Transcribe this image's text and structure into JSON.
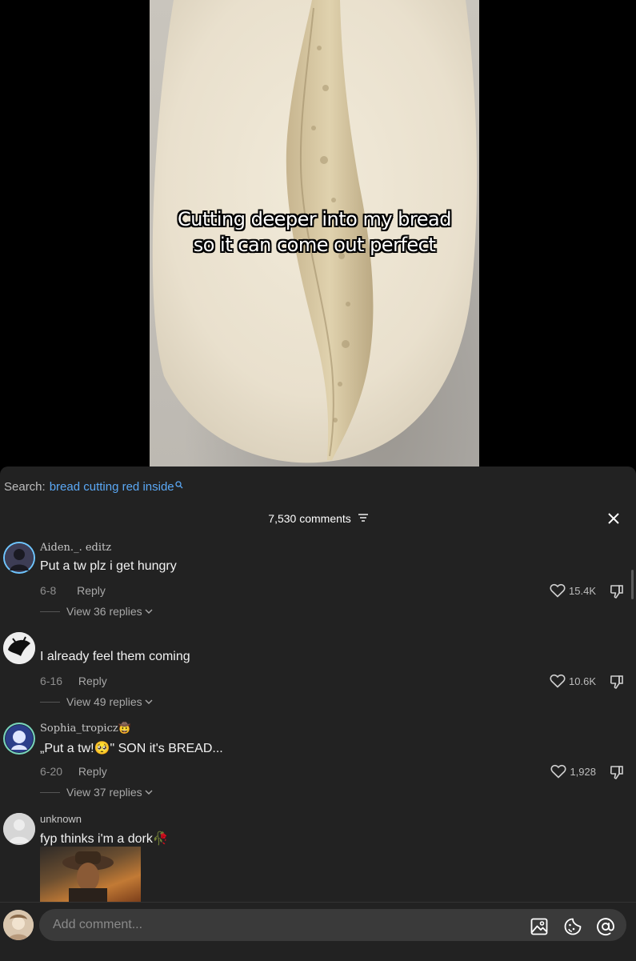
{
  "video": {
    "caption_lines": [
      "Cutting deeper into my bread",
      "so it can come out perfect"
    ]
  },
  "search": {
    "prefix": "Search:",
    "query": "bread cutting red inside"
  },
  "comments_header": {
    "count_label": "7,530 comments"
  },
  "comments": [
    {
      "username": "Aiden._. editz",
      "text": "Put a tw plz i get hungry",
      "date": "6-8",
      "reply_label": "Reply",
      "likes": "15.4K",
      "view_replies": "View 36 replies"
    },
    {
      "username": "",
      "text": "I already feel them coming",
      "date": "6-16",
      "reply_label": "Reply",
      "likes": "10.6K",
      "view_replies": "View 49 replies"
    },
    {
      "username": "Sophia_tropicz🤠",
      "text": "„Put a tw!🥺\" SON it's BREAD...",
      "date": "6-20",
      "reply_label": "Reply",
      "likes": "1,928",
      "view_replies": "View 37 replies"
    },
    {
      "username": "unknown",
      "text": "fyp thinks i'm a dork🥀"
    }
  ],
  "input": {
    "placeholder": "Add comment..."
  },
  "icons": {
    "search": "search-icon",
    "filter": "filter-icon",
    "close": "close-icon",
    "like": "heart-icon",
    "dislike": "dislike-icon",
    "chevron": "chevron-down-icon",
    "image": "image-icon",
    "emoji": "emoji-icon",
    "mention": "at-icon"
  },
  "colors": {
    "panel_bg": "#222222",
    "search_query": "#5ba8f5",
    "muted_text": "#8e8e8e"
  }
}
